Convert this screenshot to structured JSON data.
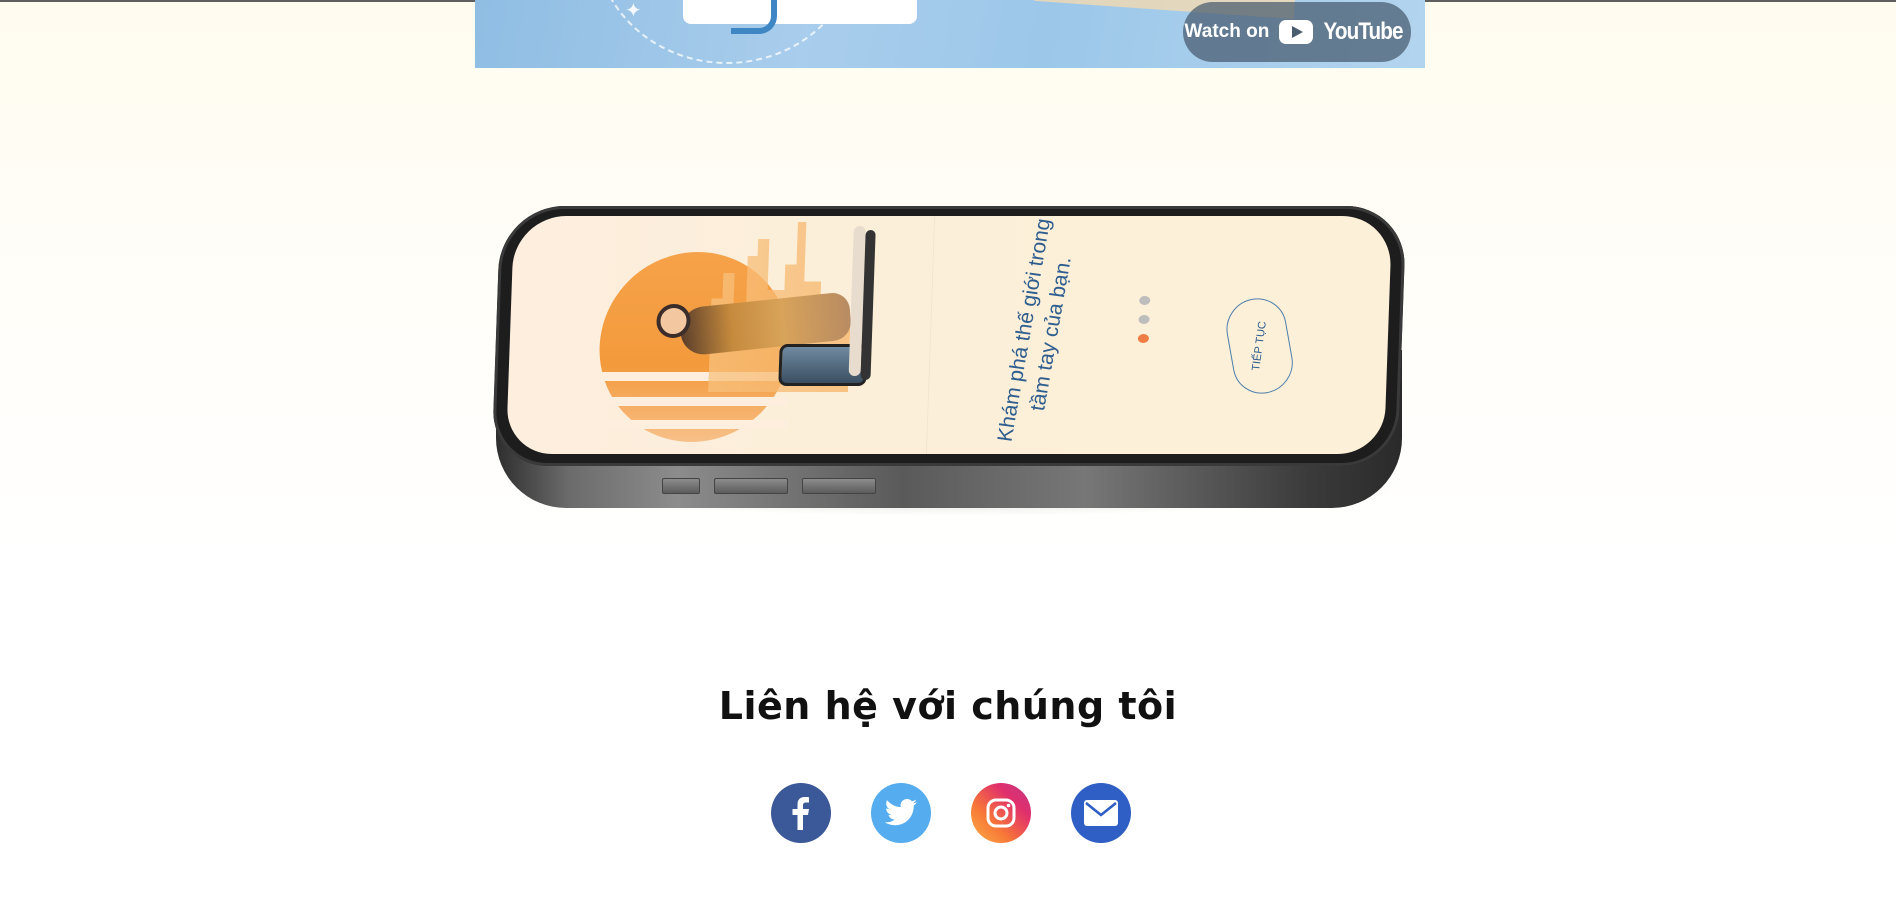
{
  "video": {
    "watch_label": "Watch on",
    "platform_label": "YouTube"
  },
  "phone": {
    "slogan_line1": "Khám phá thế giới trong",
    "slogan_line2": "tầm tay của bạn.",
    "continue_label": "TIẾP TỤC",
    "pager": {
      "count": 3,
      "active_index": 2
    }
  },
  "contact": {
    "title": "Liên hệ với chúng tôi",
    "links": [
      {
        "icon": "facebook-icon",
        "color": "#3b5998"
      },
      {
        "icon": "twitter-icon",
        "color": "#55acee"
      },
      {
        "icon": "instagram-icon",
        "colors": [
          "#e1306c",
          "#f77737",
          "#fcaf45"
        ]
      },
      {
        "icon": "email-icon",
        "color": "#2f5ec4"
      }
    ]
  }
}
